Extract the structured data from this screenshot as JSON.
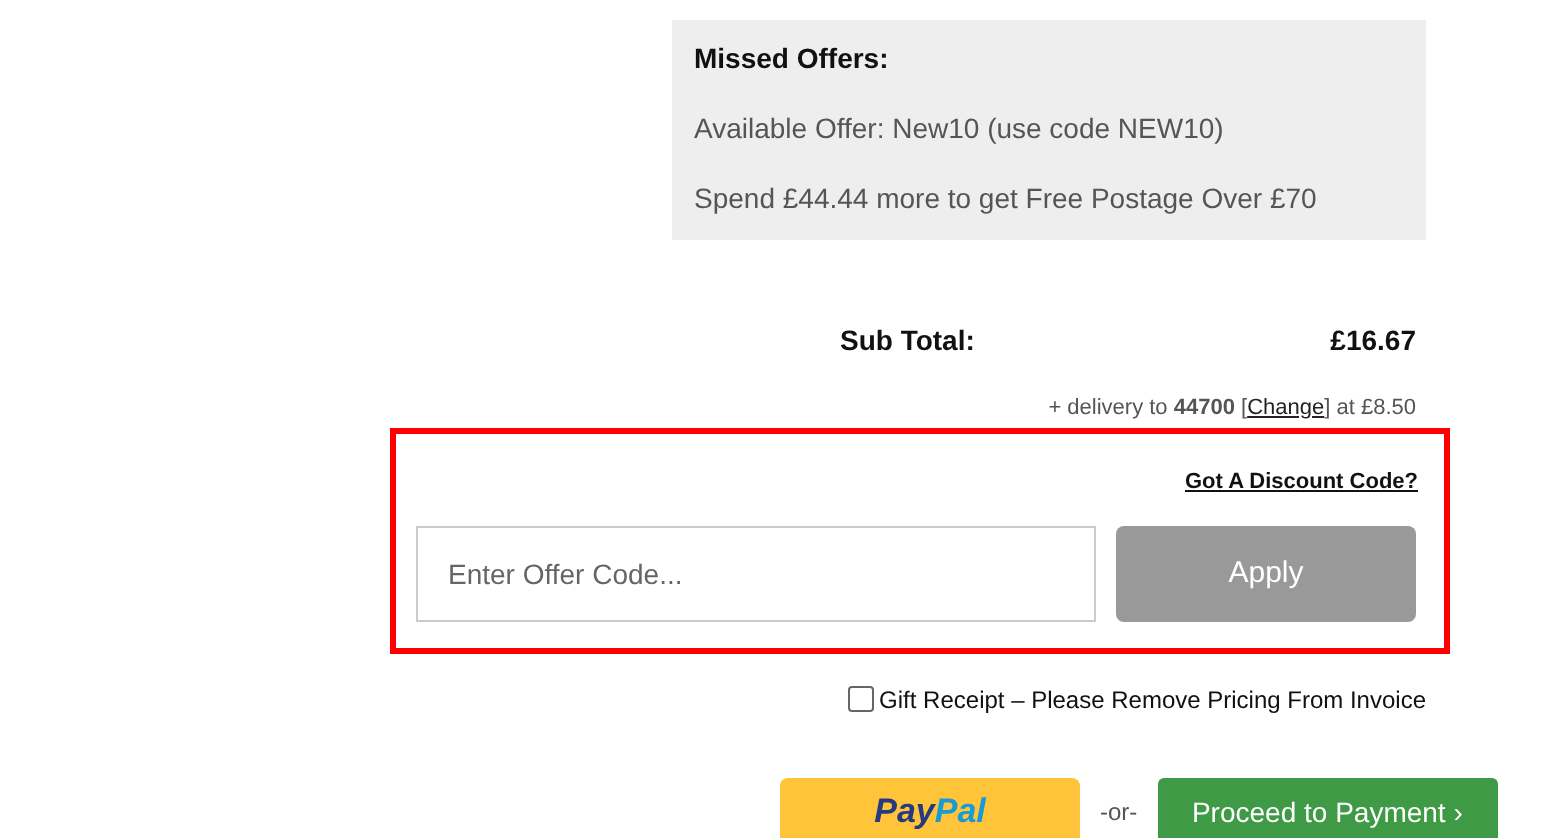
{
  "missed_offers": {
    "title": "Missed Offers:",
    "lines": [
      "Available Offer: New10 (use code NEW10)",
      "Spend £44.44 more to get Free Postage Over £70"
    ]
  },
  "subtotal": {
    "label": "Sub Total:",
    "value": "£16.67"
  },
  "delivery": {
    "prefix": "+ delivery to **44700** [",
    "link": "Change",
    "suffix": "] at £8.50"
  },
  "discount": {
    "link": "Got A Discount Code?",
    "placeholder": "Enter Offer Code...",
    "button": "Apply"
  },
  "gift_receipt": {
    "label": "Gift Receipt – Please Remove Pricing From Invoice",
    "checked": false
  },
  "paypal": {
    "part_1": "Pay",
    "part_2": "Pal"
  },
  "separator": "-or-",
  "proceed_button": "Proceed to Payment ›"
}
